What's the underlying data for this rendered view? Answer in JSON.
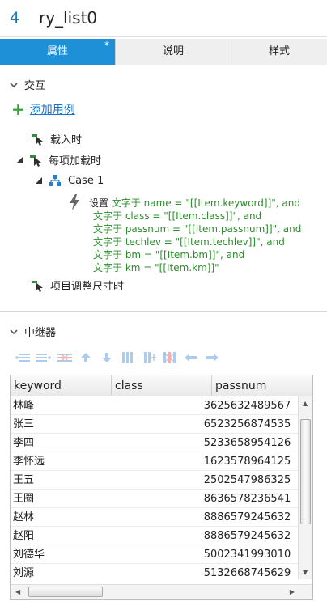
{
  "header": {
    "number": "4",
    "title": "ry_list0"
  },
  "tabs": [
    {
      "label": "属性",
      "mark": "*"
    },
    {
      "label": "说明"
    },
    {
      "label": "样式"
    }
  ],
  "interaction": {
    "section_label": "交互",
    "add_case_label": "添加用例",
    "events": {
      "on_load": "载入时",
      "on_item_load": "每项加载时",
      "on_resize": "项目调整尺寸时"
    },
    "case_label": "Case 1",
    "action": {
      "verb": "设置",
      "lines": [
        "文字于 name = \"[[Item.keyword]]\", and",
        "文字于 class = \"[[Item.class]]\", and",
        "文字于 passnum = \"[[Item.passnum]]\", and",
        "文字于 techlev = \"[[Item.techlev]]\", and",
        "文字于 bm = \"[[Item.bm]]\", and",
        "文字于 km = \"[[Item.km]]\""
      ]
    }
  },
  "repeater": {
    "section_label": "中继器",
    "columns": [
      "keyword",
      "class",
      "passnum"
    ],
    "rows": [
      [
        "林峰",
        "",
        "3625632489567"
      ],
      [
        "张三",
        "",
        "6523256874535"
      ],
      [
        "李四",
        "",
        "5233658954126"
      ],
      [
        "李怀远",
        "",
        "1623578964125"
      ],
      [
        "王五",
        "",
        "2502547986325"
      ],
      [
        "王圈",
        "",
        "8636578236541"
      ],
      [
        "赵林",
        "",
        "8886579245632"
      ],
      [
        "赵阳",
        "",
        "8886579245632"
      ],
      [
        "刘德华",
        "",
        "5002341993010"
      ],
      [
        "刘源",
        "",
        "5132668745629"
      ]
    ]
  },
  "colors": {
    "accent": "#1e90d8",
    "link": "#1a73c7",
    "action_text": "#2a8f2a"
  }
}
